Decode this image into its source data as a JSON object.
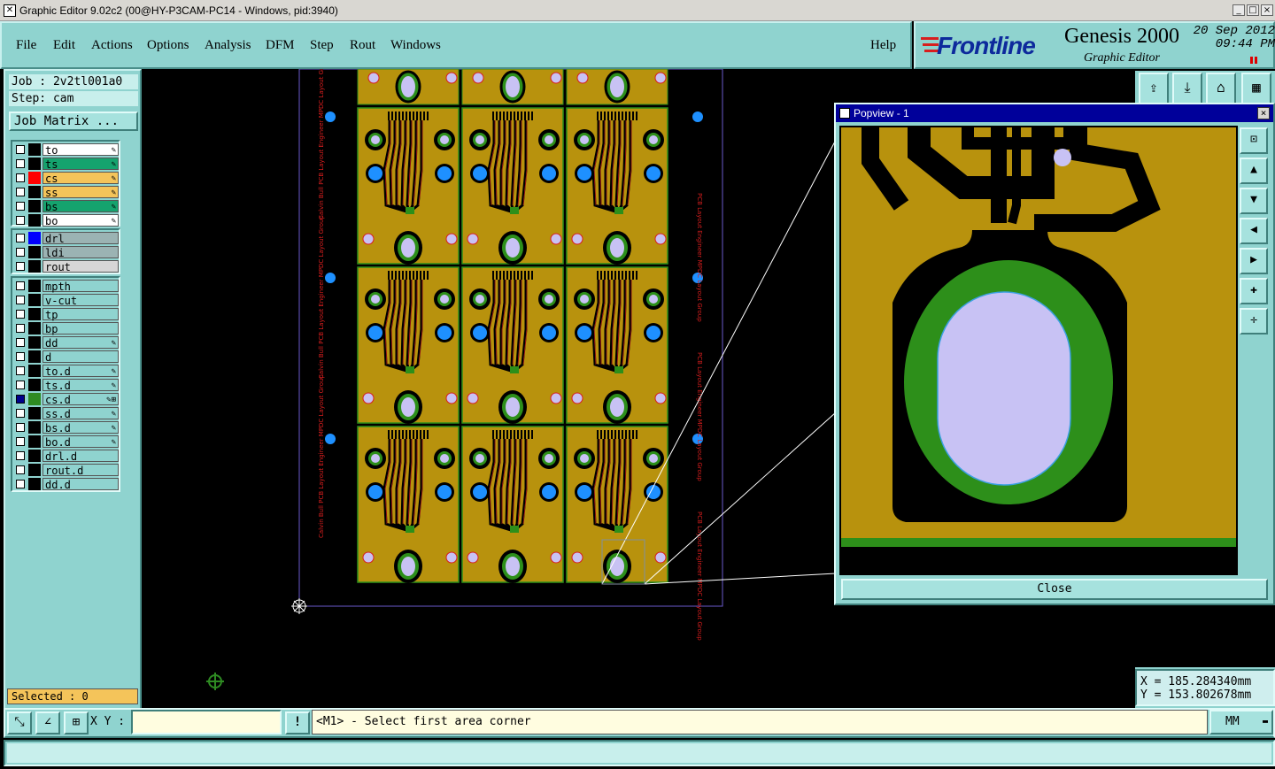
{
  "window": {
    "title": "Graphic Editor 9.02c2 (00@HY-P3CAM-PC14 - Windows, pid:3940)"
  },
  "menu": [
    "File",
    "Edit",
    "Actions",
    "Options",
    "Analysis",
    "DFM",
    "Step",
    "Rout",
    "Windows"
  ],
  "help": "Help",
  "brand": {
    "logo": "Frontline",
    "product": "Genesis 2000",
    "subtitle": "Graphic Editor",
    "date": "20 Sep 2012",
    "time": "09:44 PM"
  },
  "job": {
    "job": "Job : 2v2tl001a0",
    "step": "Step: cam",
    "matrix_btn": "Job Matrix ..."
  },
  "layers_board": [
    {
      "name": "to",
      "color": "#ffffff",
      "sw": "#000000",
      "edit": true
    },
    {
      "name": "ts",
      "color": "#15a36e",
      "sw": "#000000",
      "edit": true
    },
    {
      "name": "cs",
      "color": "#f4c45a",
      "sw": "#ff0000",
      "edit": true
    },
    {
      "name": "ss",
      "color": "#f4c45a",
      "sw": "#000000",
      "edit": true
    },
    {
      "name": "bs",
      "color": "#15a36e",
      "sw": "#000000",
      "edit": true
    },
    {
      "name": "bo",
      "color": "#ffffff",
      "sw": "#000000",
      "edit": true
    }
  ],
  "layers_drill": [
    {
      "name": "drl",
      "color": "#9bb3b3",
      "sw": "#0000ff"
    },
    {
      "name": "ldi",
      "color": "#9bb3b3",
      "sw": "#000000"
    },
    {
      "name": "rout",
      "color": "#d6d6d6",
      "sw": "#000000"
    }
  ],
  "layers_misc": [
    {
      "name": "mpth",
      "color": "#8fd3cf",
      "sw": "#000000",
      "edit": false
    },
    {
      "name": "v-cut",
      "color": "#8fd3cf",
      "sw": "#000000",
      "edit": false
    },
    {
      "name": "tp",
      "color": "#8fd3cf",
      "sw": "#000000",
      "edit": false
    },
    {
      "name": "bp",
      "color": "#8fd3cf",
      "sw": "#000000",
      "edit": false
    },
    {
      "name": "dd",
      "color": "#8fd3cf",
      "sw": "#000000",
      "edit": true
    },
    {
      "name": "d",
      "color": "#8fd3cf",
      "sw": "#000000",
      "edit": false
    },
    {
      "name": "to.d",
      "color": "#8fd3cf",
      "sw": "#000000",
      "edit": true
    },
    {
      "name": "ts.d",
      "color": "#8fd3cf",
      "sw": "#000000",
      "edit": true
    },
    {
      "name": "cs.d",
      "color": "#8fd3cf",
      "sw": "#2e8b22",
      "edit": true,
      "active": true
    },
    {
      "name": "ss.d",
      "color": "#8fd3cf",
      "sw": "#000000",
      "edit": true
    },
    {
      "name": "bs.d",
      "color": "#8fd3cf",
      "sw": "#000000",
      "edit": true
    },
    {
      "name": "bo.d",
      "color": "#8fd3cf",
      "sw": "#000000",
      "edit": true
    },
    {
      "name": "drl.d",
      "color": "#8fd3cf",
      "sw": "#000000",
      "edit": false
    },
    {
      "name": "rout.d",
      "color": "#8fd3cf",
      "sw": "#000000",
      "edit": false
    },
    {
      "name": "dd.d",
      "color": "#8fd3cf",
      "sw": "#000000",
      "edit": false
    }
  ],
  "selected": "Selected : 0",
  "popview": {
    "title": "Popview - 1",
    "close": "Close"
  },
  "coords": {
    "x": "X = 185.284340mm",
    "y": "Y = 153.802678mm"
  },
  "bottom": {
    "xy_label": "X Y :",
    "xy_value": "",
    "prompt": "<M1> - Select first area corner",
    "units": "MM"
  },
  "panel_text": {
    "left": [
      "Calvin Bull",
      "PCB Layout Engineer",
      "MPDC Layout Group"
    ],
    "right": "PCB Layout Engineer MPDC Layout Group"
  },
  "colors": {
    "copper": "#b8920d",
    "mask": "#2d8f1a",
    "drill": "#c8c2f4",
    "panel": "#8fd3cf"
  }
}
